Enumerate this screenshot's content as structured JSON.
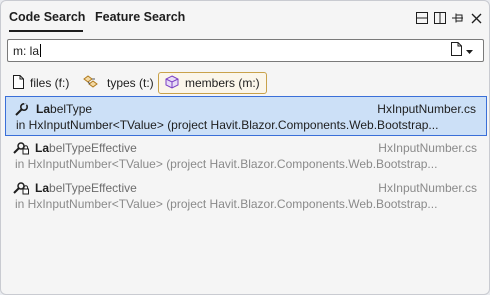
{
  "tabs": [
    {
      "label": "Code Search",
      "active": true
    },
    {
      "label": "Feature Search",
      "active": false
    }
  ],
  "title_icons": [
    "split-layout-icon",
    "dock-layout-icon",
    "pin-icon",
    "close-icon"
  ],
  "search": {
    "value": "m: la",
    "button_icon": "document-icon"
  },
  "filters": [
    {
      "label": "files (f:)",
      "icon": "file-icon",
      "active": false
    },
    {
      "label": "types (t:)",
      "icon": "types-icon",
      "active": false
    },
    {
      "label": "members (m:)",
      "icon": "cube-icon",
      "active": true
    }
  ],
  "results": [
    {
      "match": "La",
      "rest": "belType",
      "file": "HxInputNumber.cs",
      "context": "in HxInputNumber<TValue> (project Havit.Blazor.Components.Web.Bootstrap...",
      "icon": "wrench-icon",
      "selected": true
    },
    {
      "match": "La",
      "rest": "belTypeEffective",
      "file": "HxInputNumber.cs",
      "context": "in HxInputNumber<TValue> (project Havit.Blazor.Components.Web.Bootstrap...",
      "icon": "wrench-lock-icon",
      "selected": false
    },
    {
      "match": "La",
      "rest": "belTypeEffective",
      "file": "HxInputNumber.cs",
      "context": "in HxInputNumber<TValue> (project Havit.Blazor.Components.Web.Bootstrap...",
      "icon": "wrench-lock-icon",
      "selected": false
    }
  ],
  "colors": {
    "selection_bg": "#cce0f7",
    "selection_border": "#3a6fd8",
    "active_filter_border": "#c9a24a"
  }
}
